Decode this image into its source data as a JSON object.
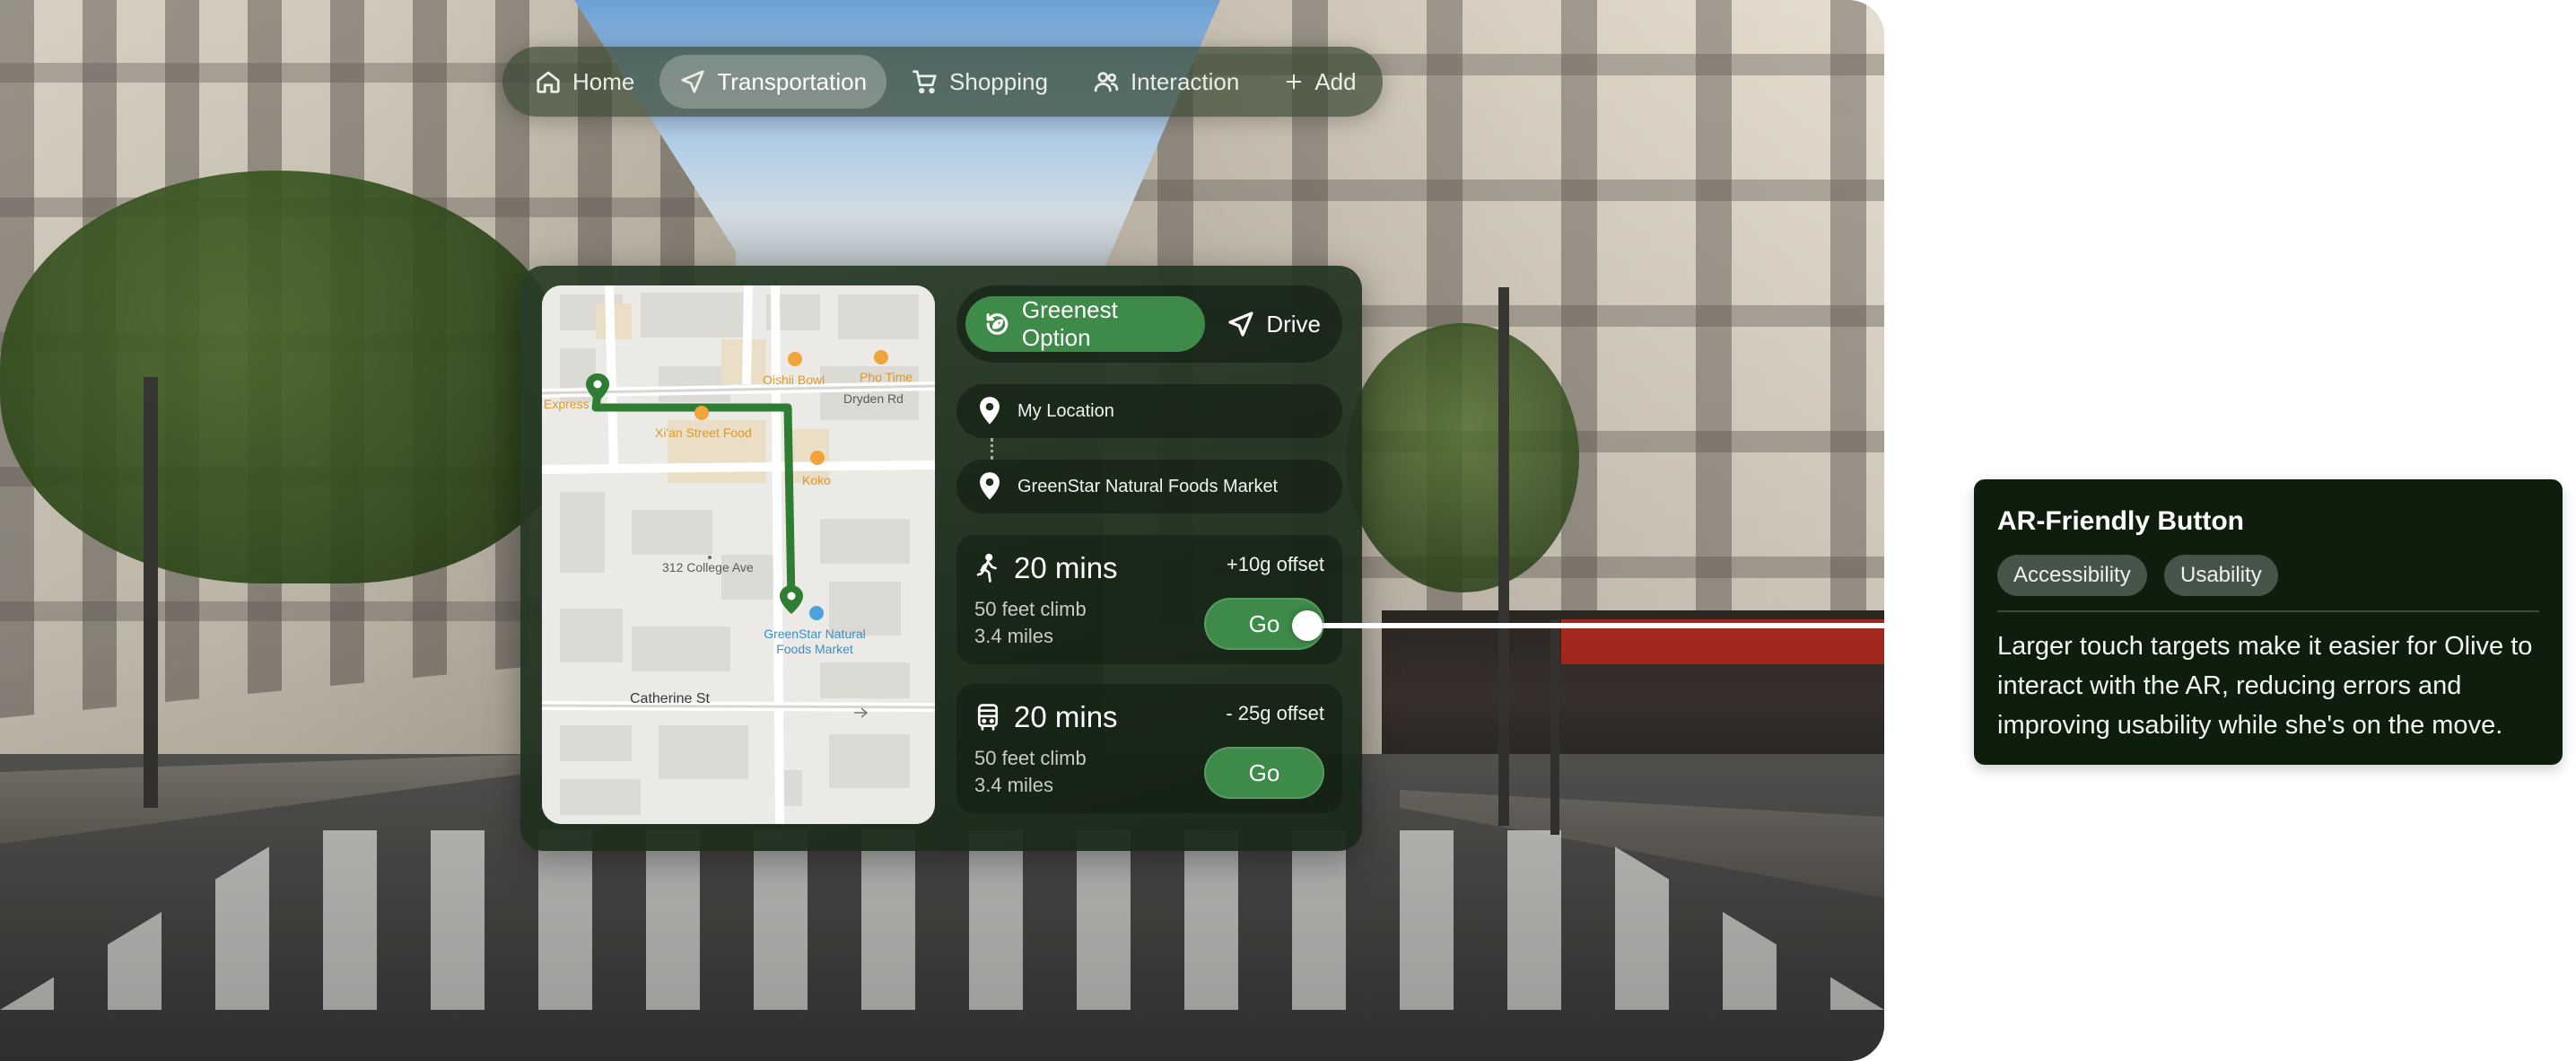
{
  "nav": {
    "items": [
      {
        "label": "Home",
        "icon": "home-icon",
        "active": false
      },
      {
        "label": "Transportation",
        "icon": "navigation-arrow-icon",
        "active": true
      },
      {
        "label": "Shopping",
        "icon": "cart-icon",
        "active": false
      },
      {
        "label": "Interaction",
        "icon": "users-icon",
        "active": false
      },
      {
        "label": "Add",
        "icon": "plus-icon",
        "active": false
      }
    ]
  },
  "map": {
    "pois": [
      "Oishii Bowl",
      "Pho Time",
      "Xi'an Street Food",
      "Koko",
      "Express"
    ],
    "streets": [
      "Dryden Rd",
      "312 College Ave",
      "Catherine St"
    ],
    "destination": [
      "GreenStar Natural",
      "Foods Market"
    ]
  },
  "mode": {
    "greenest_label": "Greenest Option",
    "drive_label": "Drive"
  },
  "locations": {
    "from": "My Location",
    "to": "GreenStar Natural Foods Market"
  },
  "routes": [
    {
      "time": "20 mins",
      "offset": "+10g offset",
      "climb": "50 feet climb",
      "distance": "3.4 miles",
      "go_label": "Go",
      "icon": "walking-icon"
    },
    {
      "time": "20 mins",
      "offset": "- 25g offset",
      "climb": "50 feet climb",
      "distance": "3.4 miles",
      "go_label": "Go",
      "icon": "bus-icon"
    }
  ],
  "annotation": {
    "title": "AR-Friendly Button",
    "tags": [
      "Accessibility",
      "Usability"
    ],
    "body": "Larger touch targets make it easier for Olive to interact with the AR, reducing errors and improving usability while she's on the move."
  },
  "colors": {
    "accent_green": "#3e8a48",
    "panel_dark": "#1c2e1b",
    "route_green": "#2e7d32",
    "annotation_bg": "#0e1e0c"
  }
}
